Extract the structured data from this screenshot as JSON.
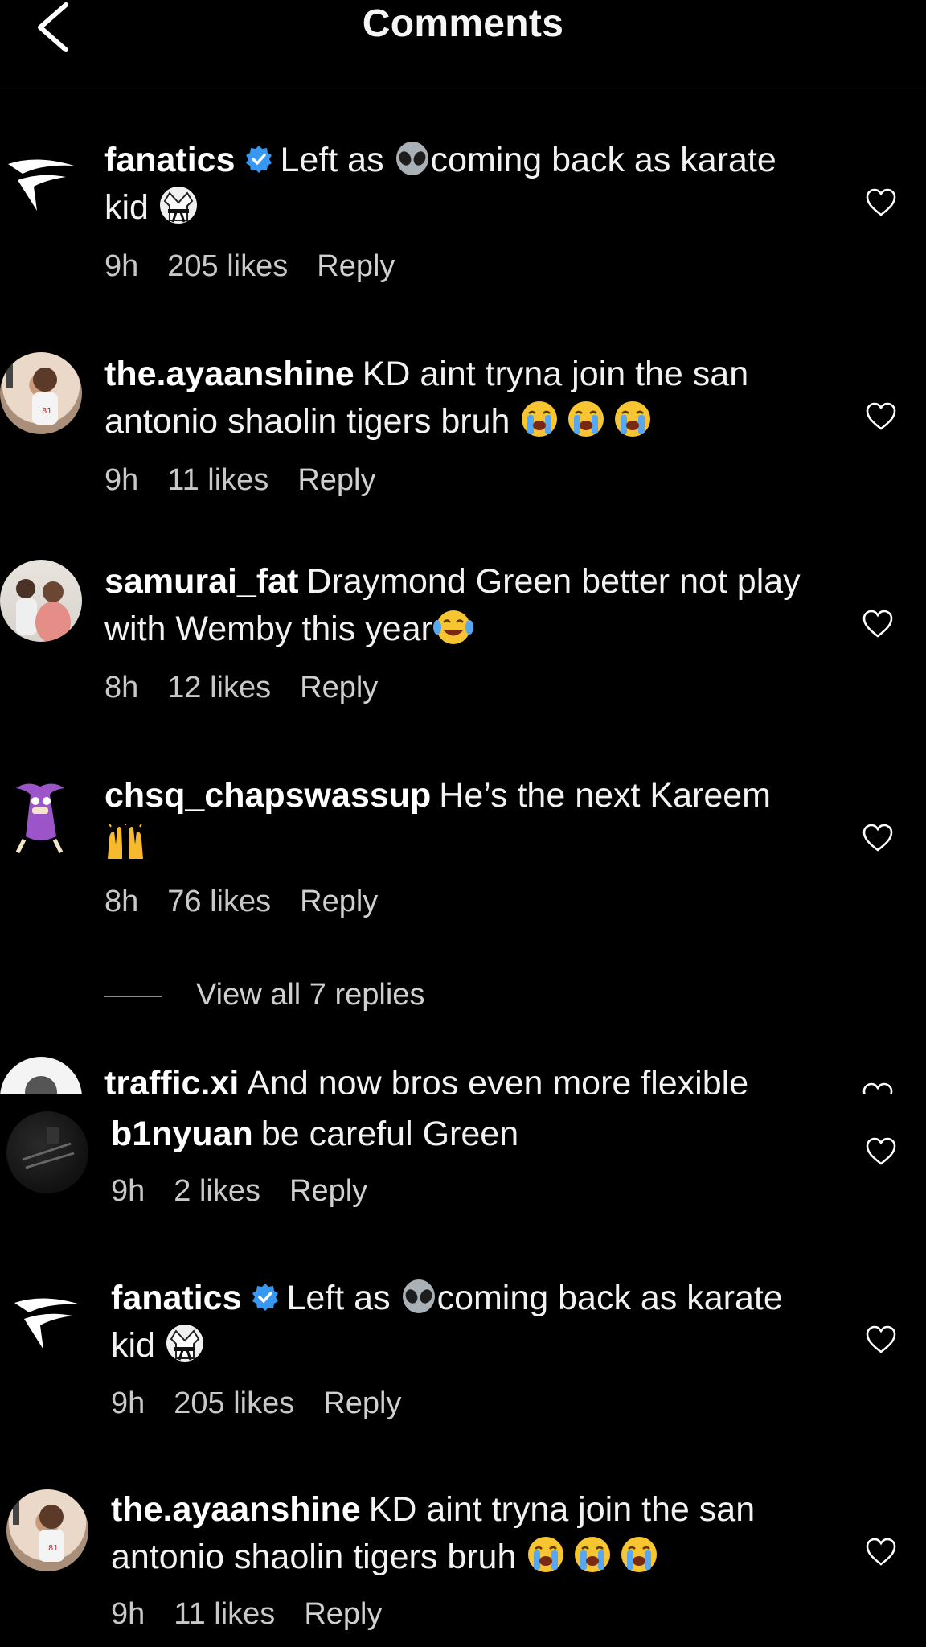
{
  "header": {
    "title": "Comments"
  },
  "comments": [
    {
      "username": "fanatics",
      "verified": true,
      "text_a": "Left as",
      "text_b": "coming back as karate kid",
      "emoji_a": "alien",
      "emoji_end": "martial-arts-uniform",
      "time": "9h",
      "likes": "205 likes",
      "reply": "Reply"
    },
    {
      "username": "the.ayaanshine",
      "text": "KD aint tryna join the san antonio shaolin tigers bruh",
      "emoji_end": "loudly-crying-face x3",
      "time": "9h",
      "likes": "11 likes",
      "reply": "Reply"
    },
    {
      "username": "samurai_fat",
      "text": "Draymond Green better not play with Wemby this year",
      "emoji_end": "face-with-tears-of-joy",
      "time": "8h",
      "likes": "12 likes",
      "reply": "Reply"
    },
    {
      "username": "chsq_chapswassup",
      "text": "He’s the next Kareem",
      "emoji_end": "raising-hands",
      "time": "8h",
      "likes": "76 likes",
      "reply": "Reply"
    },
    {
      "username": "traffic.xi",
      "text": "And now bros even more flexible"
    },
    {
      "username": "b1nyuan",
      "text": "be careful Green",
      "time": "9h",
      "likes": "2 likes",
      "reply": "Reply"
    },
    {
      "username": "fanatics",
      "verified": true,
      "text_a": "Left as",
      "text_b": "coming back as karate kid",
      "emoji_a": "alien",
      "emoji_end": "martial-arts-uniform",
      "time": "9h",
      "likes": "205 likes",
      "reply": "Reply"
    },
    {
      "username": "the.ayaanshine",
      "text": "KD aint tryna join the san antonio shaolin tigers bruh",
      "emoji_end": "loudly-crying-face x3",
      "time": "9h",
      "likes": "11 likes",
      "reply": "Reply"
    }
  ],
  "view_replies": "View all 7 replies",
  "icons": {
    "back": "chevron-left-icon",
    "like": "heart-outline-icon",
    "verified": "verified-badge-icon"
  },
  "colors": {
    "background": "#000000",
    "text": "#f2f2f2",
    "verified": "#3897f0",
    "muted": "#c8c8c8"
  }
}
